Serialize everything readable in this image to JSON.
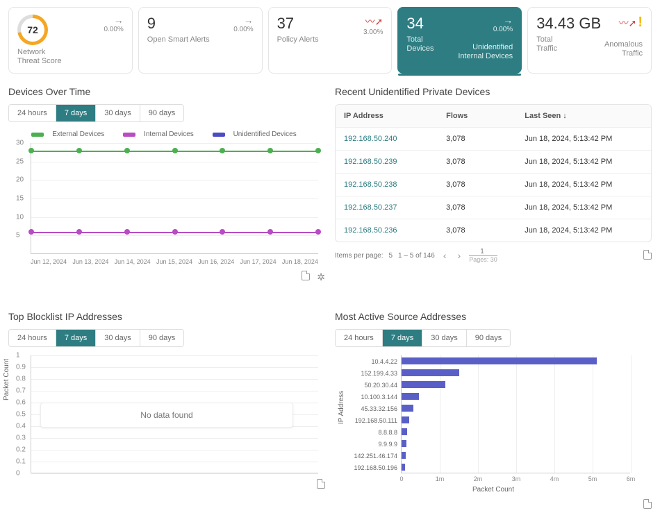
{
  "cards": {
    "threat": {
      "score": "72",
      "label": "Network\nThreat Score",
      "pct": "0.00%"
    },
    "alerts": {
      "value": "9",
      "label": "Open Smart Alerts",
      "pct": "0.00%"
    },
    "policy": {
      "value": "37",
      "label": "Policy Alerts",
      "pct": "3.00%"
    },
    "devices": {
      "value": "34",
      "label": "Total\nDevices",
      "pct": "0.00%",
      "sub": "Unidentified\nInternal Devices"
    },
    "traffic": {
      "value": "34.43 GB",
      "label": "Total\nTraffic",
      "sub": "Anomalous\nTraffic"
    }
  },
  "timeranges": [
    "24 hours",
    "7 days",
    "30 days",
    "90 days"
  ],
  "devicesOverTime": {
    "title": "Devices Over Time",
    "legend": [
      "External Devices",
      "Internal Devices",
      "Unidentified Devices"
    ]
  },
  "recentDevices": {
    "title": "Recent Unidentified Private Devices",
    "headers": [
      "IP Address",
      "Flows",
      "Last Seen"
    ],
    "rows": [
      {
        "ip": "192.168.50.240",
        "flows": "3,078",
        "seen": "Jun 18, 2024, 5:13:42 PM"
      },
      {
        "ip": "192.168.50.239",
        "flows": "3,078",
        "seen": "Jun 18, 2024, 5:13:42 PM"
      },
      {
        "ip": "192.168.50.238",
        "flows": "3,078",
        "seen": "Jun 18, 2024, 5:13:42 PM"
      },
      {
        "ip": "192.168.50.237",
        "flows": "3,078",
        "seen": "Jun 18, 2024, 5:13:42 PM"
      },
      {
        "ip": "192.168.50.236",
        "flows": "3,078",
        "seen": "Jun 18, 2024, 5:13:42 PM"
      }
    ],
    "pager": {
      "ipp": "Items per page:",
      "ipp_val": "5",
      "range": "1 – 5 of 146",
      "page": "1",
      "pages": "Pages: 30"
    }
  },
  "blocklist": {
    "title": "Top Blocklist IP Addresses",
    "ylabel": "Packet Count",
    "nodata": "No data found"
  },
  "mostActive": {
    "title": "Most Active Source Addresses",
    "ylabel": "IP Address",
    "xlabel": "Packet Count"
  },
  "chart_data": [
    {
      "type": "line",
      "title": "Devices Over Time",
      "categories": [
        "Jun 12, 2024",
        "Jun 13, 2024",
        "Jun 14, 2024",
        "Jun 15, 2024",
        "Jun 16, 2024",
        "Jun 17, 2024",
        "Jun 18, 2024"
      ],
      "ylim": [
        0,
        30
      ],
      "yticks": [
        5,
        10,
        15,
        20,
        25,
        30
      ],
      "series": [
        {
          "name": "External Devices",
          "color": "#4caf50",
          "values": [
            28,
            28,
            28,
            28,
            28,
            28,
            28
          ]
        },
        {
          "name": "Internal Devices",
          "color": "#b94bc4",
          "values": [
            6,
            6,
            6,
            6,
            6,
            6,
            6
          ]
        },
        {
          "name": "Unidentified Devices",
          "color": "#4b4bc4",
          "values": [
            null,
            null,
            null,
            null,
            null,
            null,
            null
          ]
        }
      ]
    },
    {
      "type": "bar",
      "title": "Top Blocklist IP Addresses",
      "orientation": "vertical",
      "yticks": [
        0,
        0.1,
        0.2,
        0.3,
        0.4,
        0.5,
        0.6,
        0.7,
        0.8,
        0.9,
        1
      ],
      "categories": [],
      "values": [],
      "ylabel": "Packet Count",
      "no_data": true
    },
    {
      "type": "bar",
      "title": "Most Active Source Addresses",
      "orientation": "horizontal",
      "xlabel": "Packet Count",
      "ylabel": "IP Address",
      "xlim": [
        0,
        6000000
      ],
      "xticks": [
        0,
        1000000,
        2000000,
        3000000,
        4000000,
        5000000,
        6000000
      ],
      "xtick_labels": [
        "0",
        "1m",
        "2m",
        "3m",
        "4m",
        "5m",
        "6m"
      ],
      "categories": [
        "10.4.4.22",
        "152.199.4.33",
        "50.20.30.44",
        "10.100.3.144",
        "45.33.32.156",
        "192.168.50.111",
        "8.8.8.8",
        "9.9.9.9",
        "142.251.46.174",
        "192.168.50.196"
      ],
      "values": [
        5100000,
        1500000,
        1150000,
        450000,
        300000,
        200000,
        150000,
        120000,
        100000,
        90000
      ]
    }
  ]
}
